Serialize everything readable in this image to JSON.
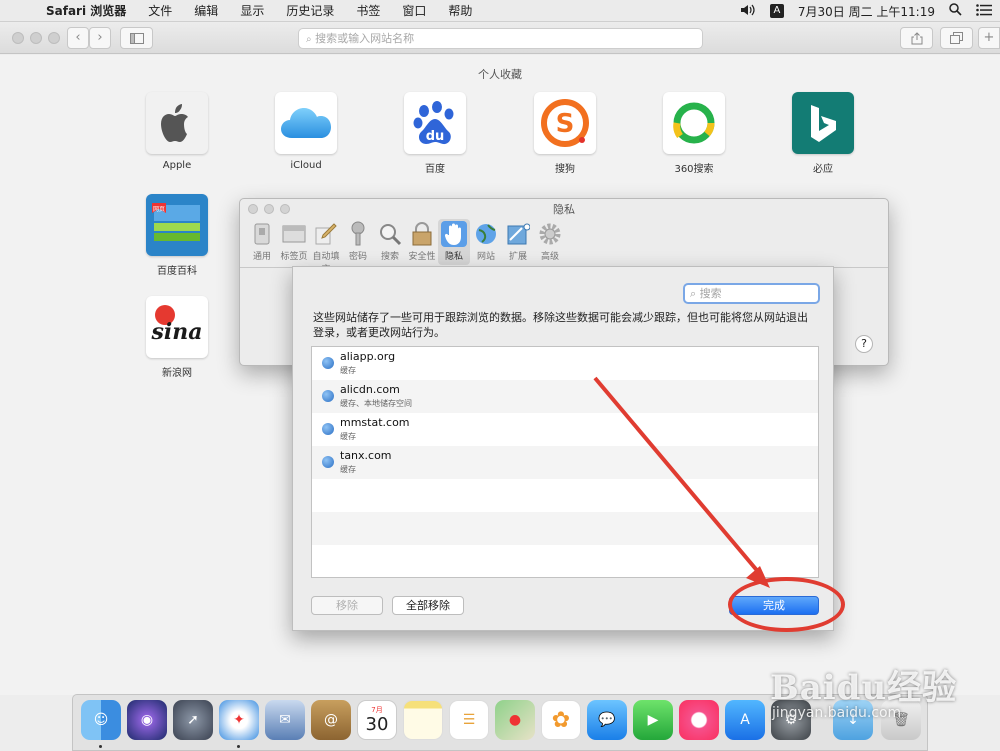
{
  "menubar": {
    "app_name": "Safari 浏览器",
    "items": [
      "文件",
      "编辑",
      "显示",
      "历史记录",
      "书签",
      "窗口",
      "帮助"
    ],
    "ime": "A",
    "clock": "7月30日 周二 上午11:19"
  },
  "toolbar": {
    "address_placeholder": "搜索或输入网站名称"
  },
  "favorites": {
    "title": "个人收藏",
    "items": [
      {
        "label": "Apple"
      },
      {
        "label": "iCloud"
      },
      {
        "label": "百度"
      },
      {
        "label": "搜狗"
      },
      {
        "label": "360搜索"
      },
      {
        "label": "必应"
      },
      {
        "label": "百度百科"
      },
      {
        "label": "新浪网"
      }
    ]
  },
  "prefs": {
    "title": "隐私",
    "tabs": [
      {
        "label": "通用",
        "icon": "switch-icon"
      },
      {
        "label": "标签页",
        "icon": "tabs-icon"
      },
      {
        "label": "自动填充",
        "icon": "pencil-icon"
      },
      {
        "label": "密码",
        "icon": "key-icon"
      },
      {
        "label": "搜索",
        "icon": "magnifier-icon"
      },
      {
        "label": "安全性",
        "icon": "lock-icon"
      },
      {
        "label": "隐私",
        "icon": "hand-icon",
        "selected": true
      },
      {
        "label": "网站",
        "icon": "globe-icon"
      },
      {
        "label": "扩展",
        "icon": "puzzle-icon"
      },
      {
        "label": "高级",
        "icon": "gear-icon"
      }
    ],
    "help": "?"
  },
  "sheet": {
    "search_placeholder": "搜索",
    "description": "这些网站储存了一些可用于跟踪浏览的数据。移除这些数据可能会减少跟踪，但也可能将您从网站退出登录，或者更改网站行为。",
    "sites": [
      {
        "domain": "aliapp.org",
        "kind": "缓存"
      },
      {
        "domain": "alicdn.com",
        "kind": "缓存、本地储存空间"
      },
      {
        "domain": "mmstat.com",
        "kind": "缓存"
      },
      {
        "domain": "tanx.com",
        "kind": "缓存"
      }
    ],
    "remove_label": "移除",
    "remove_all_label": "全部移除",
    "done_label": "完成"
  },
  "dock": {
    "calendar_month": "7月",
    "calendar_day": "30"
  },
  "watermark": {
    "logo": "Baidu经验",
    "url": "jingyan.baidu.com"
  },
  "colors": {
    "accent": "#1c6ff1",
    "annotation": "#e03c31"
  }
}
